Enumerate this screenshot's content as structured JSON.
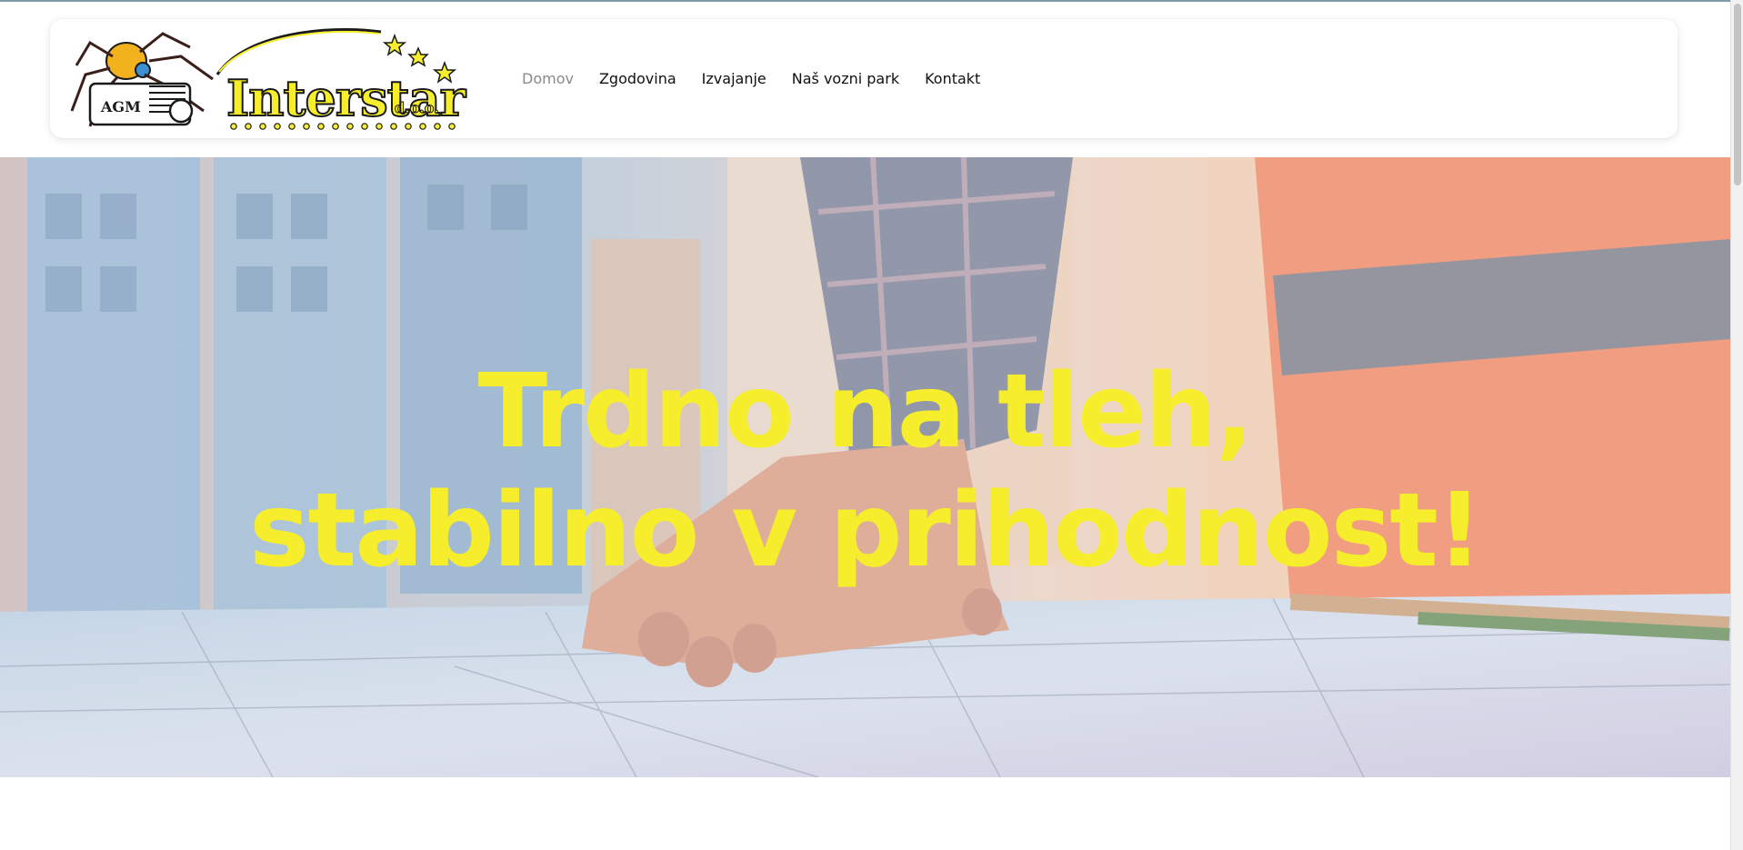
{
  "logo": {
    "badge_text": "AGM",
    "brand_text": "Interstar",
    "suffix_text": "d.o.o."
  },
  "nav": {
    "items": [
      {
        "label": "Domov",
        "active": true
      },
      {
        "label": "Zgodovina",
        "active": false
      },
      {
        "label": "Izvajanje",
        "active": false
      },
      {
        "label": "Naš vozni park",
        "active": false
      },
      {
        "label": "Kontakt",
        "active": false
      }
    ]
  },
  "hero": {
    "title_line1": "Trdno na tleh,",
    "title_line2": "stabilno v prihodnost!",
    "title_color": "#f6ee2c"
  },
  "colors": {
    "brand_yellow": "#f6ee2c",
    "nav_active": "#8a8a8a",
    "nav_text": "#111111"
  }
}
